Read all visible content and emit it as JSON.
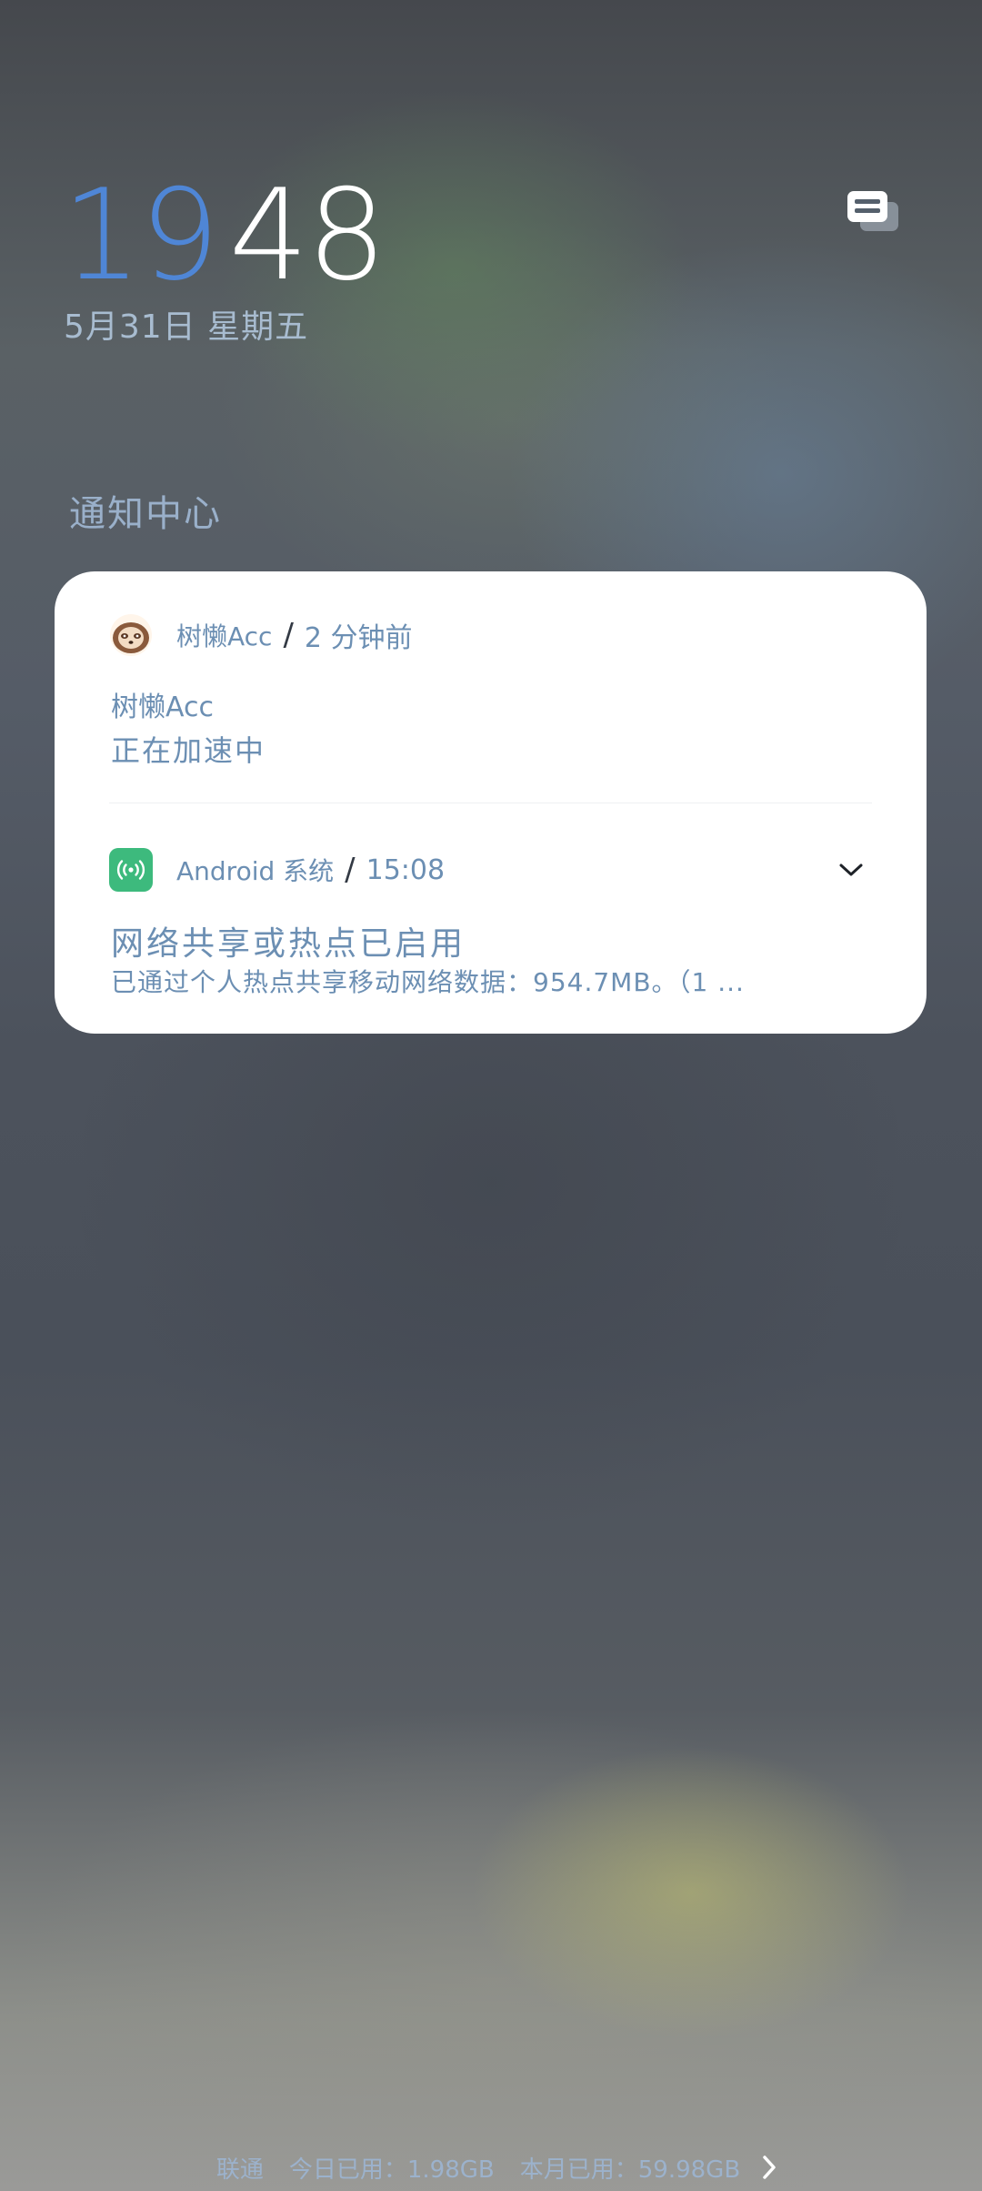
{
  "lockscreen": {
    "clock_hour": "19",
    "clock_minute": "48",
    "date": "5月31日 星期五"
  },
  "notification_center": {
    "title": "通知中心"
  },
  "notifications": [
    {
      "app_name": "树懒Acc",
      "separator": "/",
      "time": "2 分钟前",
      "title": "树懒Acc",
      "body": "正在加速中",
      "icon": "sloth-app-icon"
    },
    {
      "app_name": "Android 系统",
      "separator": "/",
      "time": "15:08",
      "title": "网络共享或热点已启用",
      "body": "已通过个人热点共享移动网络数据：954.7MB。（1 ...",
      "icon": "hotspot-icon"
    }
  ],
  "footer": {
    "carrier": "联通",
    "today_used": "今日已用：1.98GB",
    "month_used": "本月已用：59.98GB"
  },
  "colors": {
    "clock_hour": "#4f86d6",
    "clock_minute": "#ffffff",
    "accent_text": "#6c8fb3",
    "hotspot_icon_bg": "#3dba7d",
    "card_bg": "#ffffff"
  }
}
